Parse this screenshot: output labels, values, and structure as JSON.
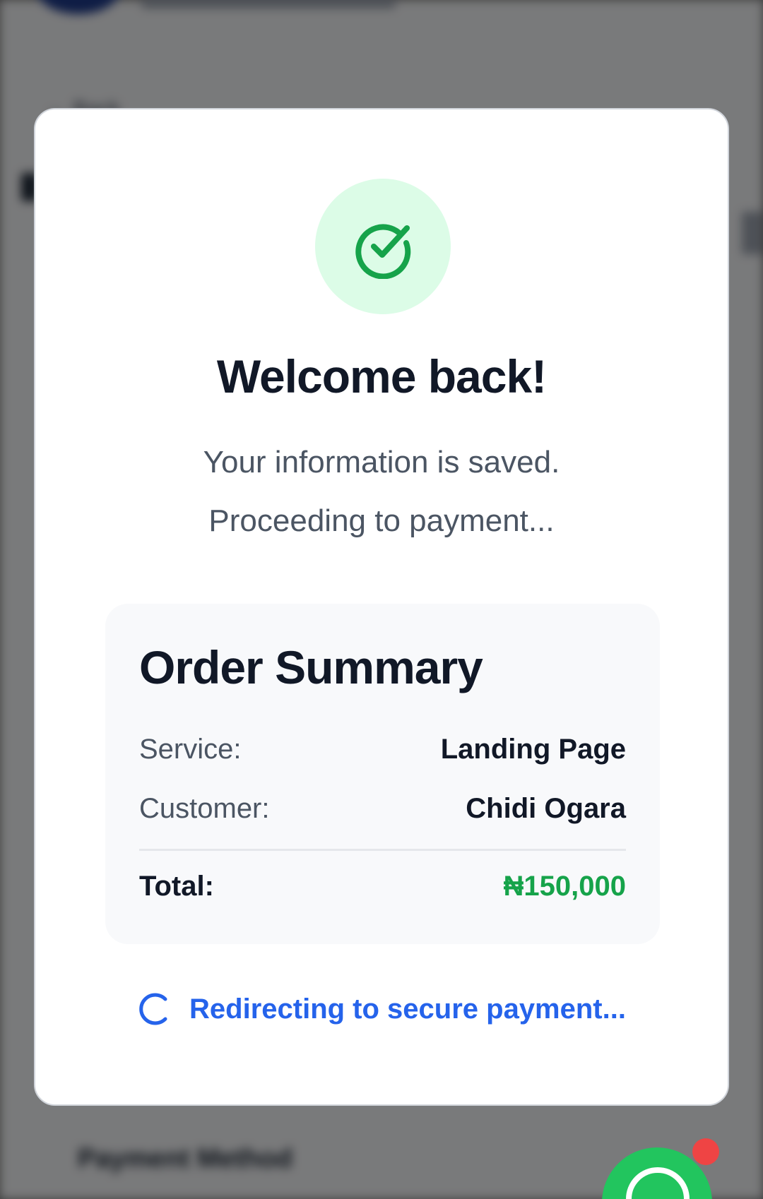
{
  "modal": {
    "title": "Welcome back!",
    "subtitle_line1": "Your information is saved.",
    "subtitle_line2": "Proceeding to payment..."
  },
  "order_summary": {
    "title": "Order Summary",
    "rows": [
      {
        "label": "Service:",
        "value": "Landing Page"
      },
      {
        "label": "Customer:",
        "value": "Chidi Ogara"
      }
    ],
    "total": {
      "label": "Total:",
      "value": "₦150,000"
    }
  },
  "status": {
    "redirect_text": "Redirecting to secure payment..."
  },
  "background": {
    "back_label": "Back",
    "payment_method_heading": "Payment Method"
  },
  "colors": {
    "accent_blue": "#2563eb",
    "success_green": "#16a34a",
    "success_bg": "#dcfce7",
    "whatsapp_green": "#22c55e",
    "notification_red": "#ef4444"
  },
  "icons": {
    "success": "check-circle-icon",
    "loading": "spinner-icon",
    "chat": "whatsapp-icon"
  }
}
